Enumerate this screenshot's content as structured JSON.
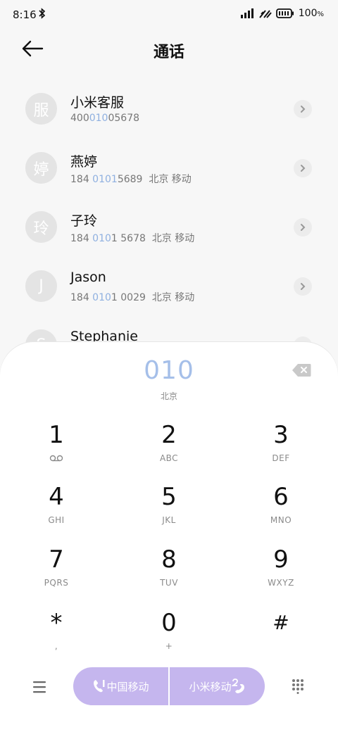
{
  "status": {
    "time": "8:16",
    "battery": "100"
  },
  "header": {
    "title": "通话"
  },
  "contacts": [
    {
      "avatar": "服",
      "name": "小米客服",
      "pre": "400",
      "hl": "010",
      "post": "05678",
      "loc": ""
    },
    {
      "avatar": "婷",
      "name": "燕婷",
      "pre": "184 ",
      "hl": "0101",
      "post": "5689",
      "loc": "北京 移动"
    },
    {
      "avatar": "玲",
      "name": "子玲",
      "pre": "184 ",
      "hl": "010",
      "post": "1 5678",
      "loc": "北京 移动"
    },
    {
      "avatar": "J",
      "name": "Jason",
      "pre": "184 ",
      "hl": "010",
      "post": "1 0029",
      "loc": "北京 移动"
    },
    {
      "avatar": "S",
      "name": "Stephanie",
      "pre": "",
      "hl": "",
      "post": "",
      "loc": ""
    }
  ],
  "dialer": {
    "entered": "010",
    "location": "北京",
    "keys": [
      {
        "digit": "1",
        "letters": ""
      },
      {
        "digit": "2",
        "letters": "ABC"
      },
      {
        "digit": "3",
        "letters": "DEF"
      },
      {
        "digit": "4",
        "letters": "GHI"
      },
      {
        "digit": "5",
        "letters": "JKL"
      },
      {
        "digit": "6",
        "letters": "MNO"
      },
      {
        "digit": "7",
        "letters": "PQRS"
      },
      {
        "digit": "8",
        "letters": "TUV"
      },
      {
        "digit": "9",
        "letters": "WXYZ"
      },
      {
        "digit": "*",
        "letters": ","
      },
      {
        "digit": "0",
        "letters": "+"
      },
      {
        "digit": "#",
        "letters": ""
      }
    ]
  },
  "call": {
    "sim1": "中国移动",
    "sim2": "小米移动"
  },
  "colors": {
    "accent": "#c5b6ee",
    "digits": "#a5bfe9"
  },
  "icons": [
    "bluetooth-icon",
    "signal-icon",
    "network-icon",
    "battery-icon",
    "back-arrow-icon",
    "chevron-right-icon",
    "backspace-icon",
    "voicemail-icon",
    "menu-icon",
    "phone-sim1-icon",
    "phone-sim2-icon",
    "dialpad-icon"
  ]
}
